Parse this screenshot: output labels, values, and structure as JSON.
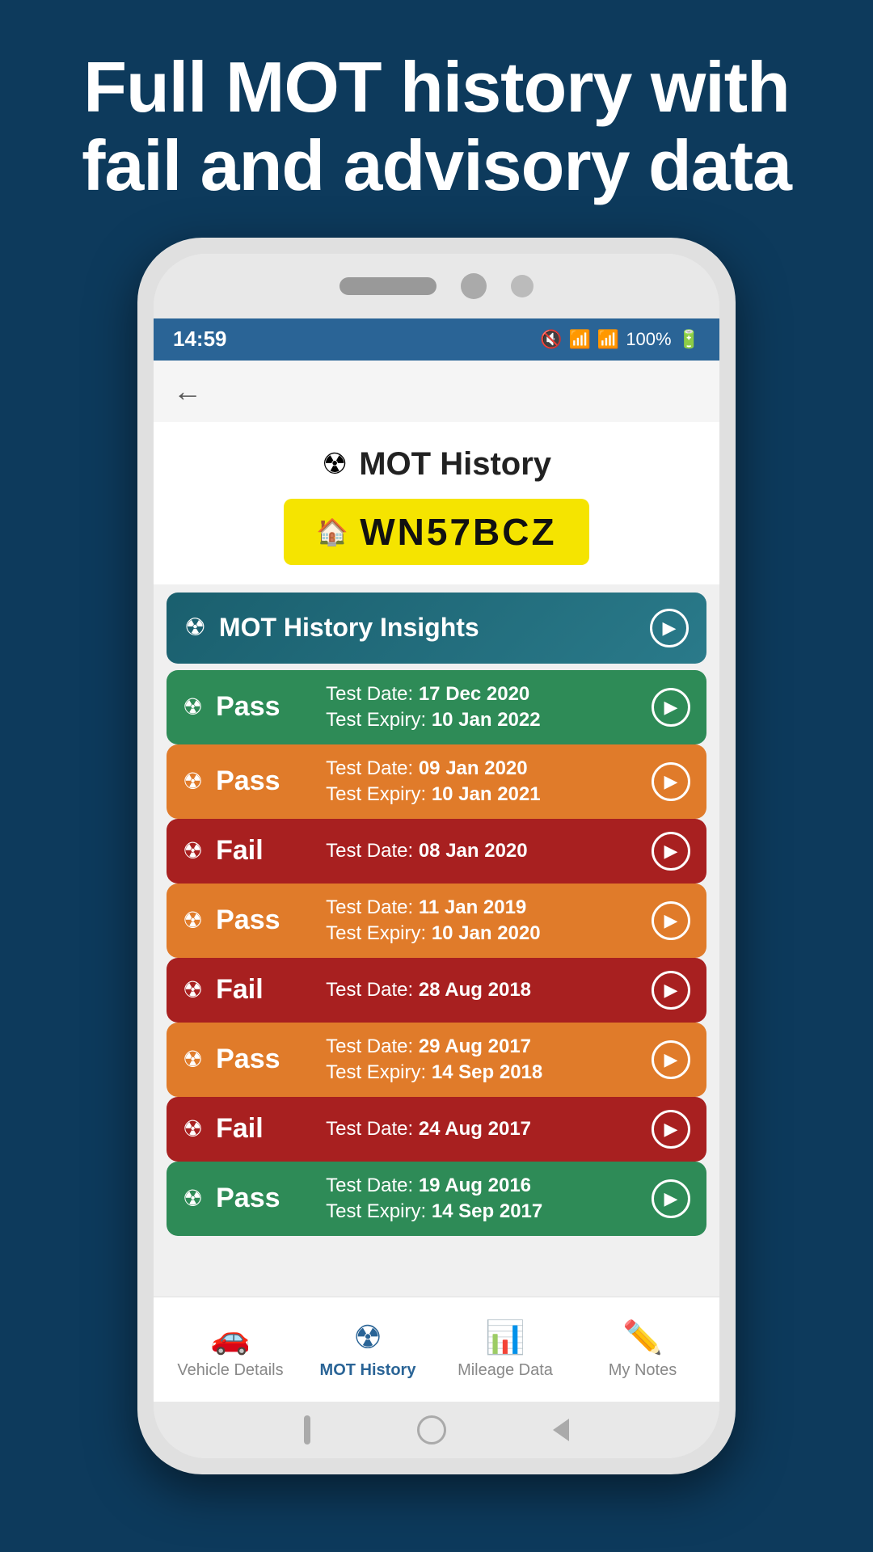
{
  "hero": {
    "title": "Full MOT history with fail and advisory data"
  },
  "status_bar": {
    "time": "14:59",
    "battery": "100%"
  },
  "page": {
    "title": "MOT History",
    "plate": "WN57BCZ"
  },
  "insights": {
    "title": "MOT History Insights"
  },
  "mot_records": [
    {
      "status": "Pass",
      "color_class": "pass-green",
      "test_date_label": "Test Date:",
      "test_date": "17 Dec 2020",
      "expiry_label": "Test Expiry:",
      "expiry_date": "10 Jan 2022"
    },
    {
      "status": "Pass",
      "color_class": "pass-orange",
      "test_date_label": "Test Date:",
      "test_date": "09 Jan 2020",
      "expiry_label": "Test Expiry:",
      "expiry_date": "10 Jan 2021"
    },
    {
      "status": "Fail",
      "color_class": "fail-red",
      "test_date_label": "Test Date:",
      "test_date": "08 Jan 2020",
      "expiry_label": null,
      "expiry_date": null
    },
    {
      "status": "Pass",
      "color_class": "pass-orange",
      "test_date_label": "Test Date:",
      "test_date": "11 Jan 2019",
      "expiry_label": "Test Expiry:",
      "expiry_date": "10 Jan 2020"
    },
    {
      "status": "Fail",
      "color_class": "fail-red",
      "test_date_label": "Test Date:",
      "test_date": "28 Aug 2018",
      "expiry_label": null,
      "expiry_date": null
    },
    {
      "status": "Pass",
      "color_class": "pass-orange",
      "test_date_label": "Test Date:",
      "test_date": "29 Aug 2017",
      "expiry_label": "Test Expiry:",
      "expiry_date": "14 Sep 2018"
    },
    {
      "status": "Fail",
      "color_class": "fail-red",
      "test_date_label": "Test Date:",
      "test_date": "24 Aug 2017",
      "expiry_label": null,
      "expiry_date": null
    },
    {
      "status": "Pass",
      "color_class": "pass-green",
      "test_date_label": "Test Date:",
      "test_date": "19 Aug 2016",
      "expiry_label": "Test Expiry:",
      "expiry_date": "14 Sep 2017"
    }
  ],
  "bottom_nav": {
    "items": [
      {
        "label": "Vehicle Details",
        "icon": "🚗",
        "active": false
      },
      {
        "label": "MOT History",
        "icon": "☢",
        "active": true
      },
      {
        "label": "Mileage Data",
        "icon": "📊",
        "active": false
      },
      {
        "label": "My Notes",
        "icon": "✏️",
        "active": false
      }
    ]
  }
}
